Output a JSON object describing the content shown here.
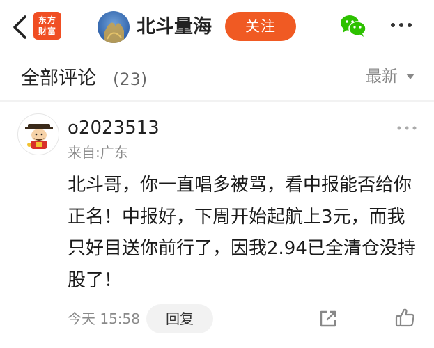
{
  "header": {
    "back_icon": "chevron-left-icon",
    "logo_line1": "东方",
    "logo_line2": "财富",
    "title": "北斗量海",
    "follow_label": "关注",
    "wechat_icon": "wechat-icon",
    "more_icon": "more-dots-icon",
    "accent_color": "#f05a23"
  },
  "comments_section": {
    "title": "全部评论",
    "count": "(23)",
    "sort_label": "最新",
    "sort_icon": "triangle-down-icon"
  },
  "comment": {
    "username": "o2023513",
    "location": "来自:广东",
    "text": "北斗哥，你一直唱多被骂，看中报能否给你正名！中报好，下周开始起航上3元，而我只好目送你前行了，因我2.94已全清仓没持股了！",
    "time": "今天 15:58",
    "reply_label": "回复",
    "share_icon": "share-icon",
    "like_icon": "thumbs-up-icon",
    "more_icon": "more-dots-icon"
  }
}
